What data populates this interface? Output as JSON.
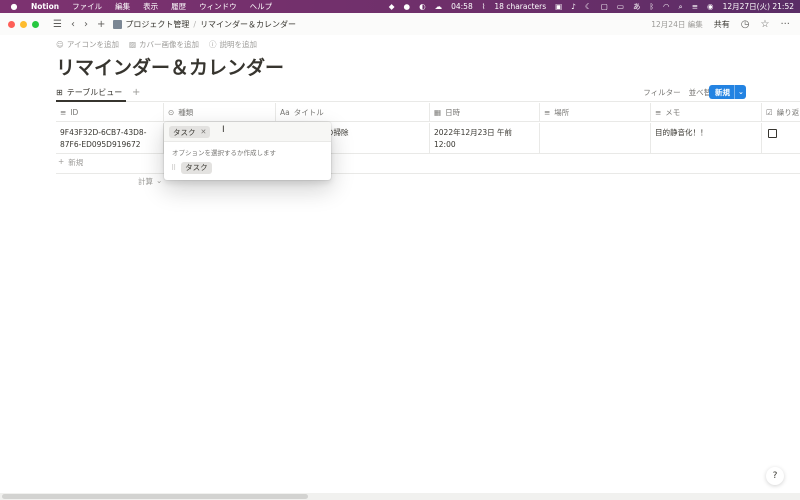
{
  "menubar": {
    "items": [
      "Notion",
      "ファイル",
      "編集",
      "表示",
      "履歴",
      "ウィンドウ",
      "ヘルプ"
    ],
    "timer": "04:58",
    "char_count": "18 characters",
    "datetime": "12月27日(火) 21:52"
  },
  "titlebar": {
    "breadcrumb_1": "プロジェクト管理",
    "breadcrumb_2": "リマインダー＆カレンダー",
    "edited": "12月24日 編集",
    "share": "共有"
  },
  "page": {
    "add_icon": "アイコンを追加",
    "add_cover": "カバー画像を追加",
    "add_description": "説明を追加",
    "title": "リマインダー＆カレンダー"
  },
  "view": {
    "tab_label": "テーブルビュー",
    "filter": "フィルター",
    "sort": "並べ替え",
    "new_button": "新規"
  },
  "table": {
    "columns": [
      "ID",
      "種類",
      "タイトル",
      "日時",
      "場所",
      "メモ",
      "繰り返"
    ],
    "row": {
      "id": "9F43F32D-6CB7-43D8-87F6-ED095D919672",
      "title": "の掃除",
      "date": "2022年12月23日 午前 12:00",
      "memo": "目的静音化！！"
    },
    "add_row": "新規",
    "calc": "計算"
  },
  "popover": {
    "selected_tag": "タスク",
    "hint": "オプションを選択するか作成します",
    "option": "タスク"
  },
  "help": "?"
}
